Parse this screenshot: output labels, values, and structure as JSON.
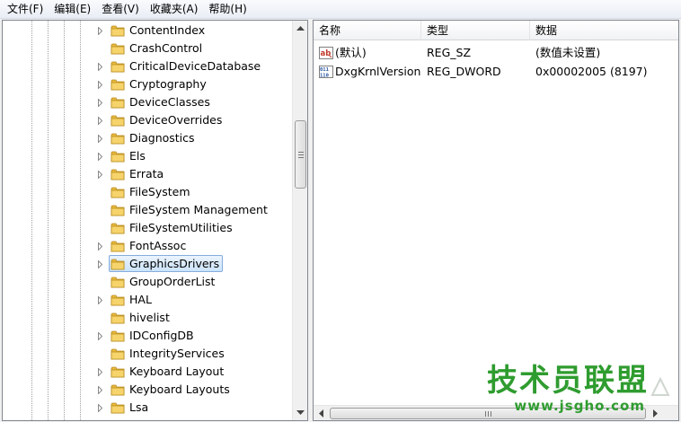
{
  "menubar": {
    "items": [
      {
        "label": "文件(F)"
      },
      {
        "label": "编辑(E)"
      },
      {
        "label": "查看(V)"
      },
      {
        "label": "收藏夹(A)"
      },
      {
        "label": "帮助(H)"
      }
    ]
  },
  "tree": {
    "nodes": [
      {
        "label": "ContentIndex",
        "expandable": true
      },
      {
        "label": "CrashControl",
        "expandable": false
      },
      {
        "label": "CriticalDeviceDatabase",
        "expandable": true
      },
      {
        "label": "Cryptography",
        "expandable": true
      },
      {
        "label": "DeviceClasses",
        "expandable": true
      },
      {
        "label": "DeviceOverrides",
        "expandable": true
      },
      {
        "label": "Diagnostics",
        "expandable": true
      },
      {
        "label": "Els",
        "expandable": true
      },
      {
        "label": "Errata",
        "expandable": true
      },
      {
        "label": "FileSystem",
        "expandable": false
      },
      {
        "label": "FileSystem Management",
        "expandable": false
      },
      {
        "label": "FileSystemUtilities",
        "expandable": false
      },
      {
        "label": "FontAssoc",
        "expandable": true
      },
      {
        "label": "GraphicsDrivers",
        "expandable": true,
        "selected": true
      },
      {
        "label": "GroupOrderList",
        "expandable": false
      },
      {
        "label": "HAL",
        "expandable": true
      },
      {
        "label": "hivelist",
        "expandable": false
      },
      {
        "label": "IDConfigDB",
        "expandable": true
      },
      {
        "label": "IntegrityServices",
        "expandable": false
      },
      {
        "label": "Keyboard Layout",
        "expandable": true
      },
      {
        "label": "Keyboard Layouts",
        "expandable": true
      },
      {
        "label": "Lsa",
        "expandable": true
      }
    ]
  },
  "listview": {
    "columns": [
      {
        "label": "名称"
      },
      {
        "label": "类型"
      },
      {
        "label": "数据"
      }
    ],
    "rows": [
      {
        "icon": "string-value-icon",
        "name": "(默认)",
        "type": "REG_SZ",
        "data": "(数值未设置)"
      },
      {
        "icon": "binary-value-icon",
        "name": "DxgKrnlVersion",
        "type": "REG_DWORD",
        "data": "0x00002005 (8197)"
      }
    ]
  },
  "watermark": {
    "title": "技术员联盟",
    "url": "www.jsgho.com"
  }
}
